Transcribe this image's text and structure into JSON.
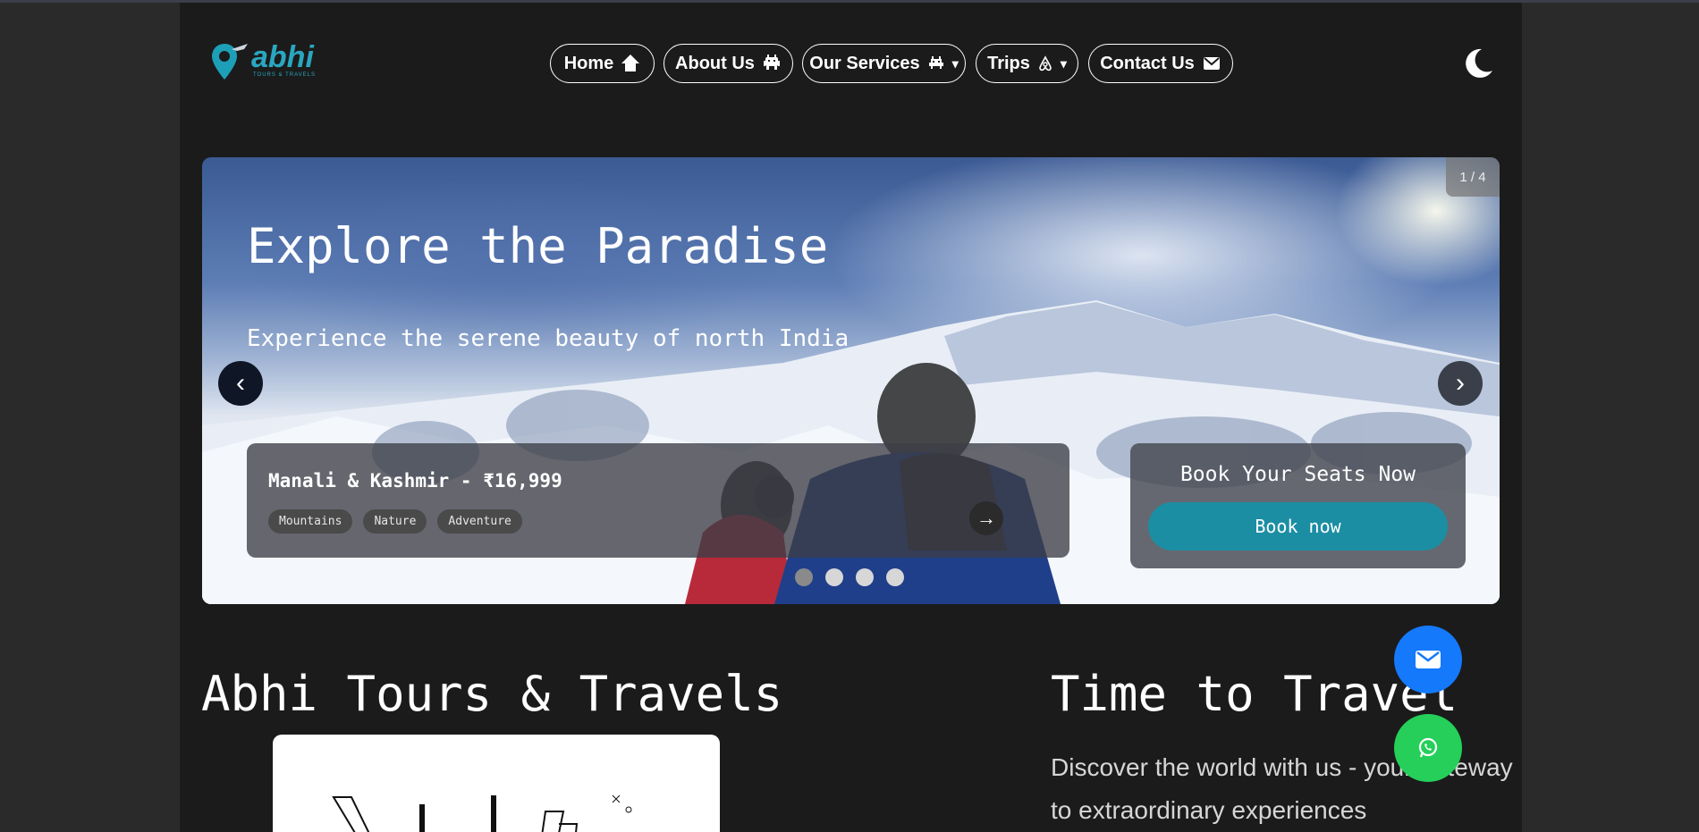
{
  "header": {
    "logo_text": "abhi",
    "logo_subtext": "TOURS & TRAVELS",
    "nav": [
      {
        "label": "Home",
        "icon": "home-icon",
        "caret": false
      },
      {
        "label": "About Us",
        "icon": "invader-icon",
        "caret": false
      },
      {
        "label": "Our Services",
        "icon": "alien-icon",
        "caret": true
      },
      {
        "label": "Trips",
        "icon": "airbnb-icon",
        "caret": true
      },
      {
        "label": "Contact Us",
        "icon": "mail-icon",
        "caret": false
      }
    ],
    "caret_glyph": "▾",
    "theme_toggle_icon": "moon-icon"
  },
  "hero": {
    "counter": "1 / 4",
    "title": "Explore the Paradise",
    "subtitle": "Experience the serene beauty of north India",
    "prev_glyph": "‹",
    "next_glyph": "›",
    "trip": {
      "title": "Manali & Kashmir - ₹16,999",
      "tags": [
        "Mountains",
        "Nature",
        "Adventure"
      ],
      "go_glyph": "→"
    },
    "booking": {
      "title": "Book Your Seats Now",
      "button": "Book now"
    },
    "dots": [
      {
        "active": true
      },
      {
        "active": false
      },
      {
        "active": false
      },
      {
        "active": false
      }
    ]
  },
  "about": {
    "title": "Abhi Tours & Travels"
  },
  "travel": {
    "title": "Time to Travel",
    "description": "Discover the world with us - your gateway to extraordinary experiences"
  },
  "floating": {
    "mail_icon": "mail-icon",
    "whatsapp_icon": "whatsapp-icon",
    "mail_color": "#1479fb",
    "whatsapp_color": "#25cf59"
  },
  "colors": {
    "page_bg": "#1b1b1b",
    "accent": "#1c8ea3",
    "logo": "#2aa7c0"
  }
}
